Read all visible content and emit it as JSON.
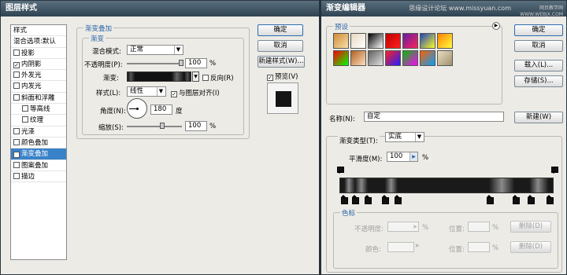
{
  "layer_style": {
    "title": "图层样式",
    "sidebar": [
      {
        "label": "样式",
        "checked": null,
        "indent": false
      },
      {
        "label": "混合选项:默认",
        "checked": null,
        "indent": false
      },
      {
        "label": "投影",
        "checked": false,
        "indent": false
      },
      {
        "label": "内阴影",
        "checked": true,
        "indent": false
      },
      {
        "label": "外发光",
        "checked": false,
        "indent": false
      },
      {
        "label": "内发光",
        "checked": false,
        "indent": false
      },
      {
        "label": "斜面和浮雕",
        "checked": false,
        "indent": false
      },
      {
        "label": "等高线",
        "checked": false,
        "indent": true
      },
      {
        "label": "纹理",
        "checked": false,
        "indent": true
      },
      {
        "label": "光泽",
        "checked": false,
        "indent": false
      },
      {
        "label": "颜色叠加",
        "checked": false,
        "indent": false
      },
      {
        "label": "渐变叠加",
        "checked": true,
        "indent": false,
        "selected": true
      },
      {
        "label": "图案叠加",
        "checked": false,
        "indent": false
      },
      {
        "label": "描边",
        "checked": false,
        "indent": false
      }
    ],
    "section_title": "渐变叠加",
    "subsection_title": "渐变",
    "blend_mode_label": "混合模式:",
    "blend_mode_value": "正常",
    "opacity_label": "不透明度(P):",
    "opacity_value": "100",
    "opacity_unit": "%",
    "gradient_label": "渐变:",
    "reverse_label": "反向(R)",
    "reverse_checked": false,
    "style_label": "样式(L):",
    "style_value": "线性",
    "align_label": "与图层对齐(I)",
    "align_checked": true,
    "angle_label": "角度(N):",
    "angle_value": "180",
    "angle_unit": "度",
    "scale_label": "缩放(S):",
    "scale_value": "100",
    "scale_unit": "%",
    "ok_label": "确定",
    "cancel_label": "取消",
    "new_style_label": "新建样式(W)...",
    "preview_label": "预览(V)",
    "preview_checked": true
  },
  "gradient_editor": {
    "title": "渐变编辑器",
    "watermark": "思缘设计论坛 www.missyuan.com",
    "watermark2": "网页教学网 WWW.WEBJX.COM",
    "presets_label": "预设",
    "presets_menu_icon": "arrow-right-icon",
    "presets": [
      [
        "#d08a3a|#f6e0a6",
        "#e8d8c0|#fff",
        "#000|#fff",
        "#c00000|#ff2020",
        "#6020a0|#ff2060",
        "#2040c0|#ffff20",
        "#ff8000|#ffff40"
      ],
      [
        "#ff0000|#00ff00",
        "#b06020|#ffe0c0",
        "#606060|#e0e0e0",
        "#ff2020|#2020ff",
        "#00c000|#ff00ff",
        "#ff6000|#00a0ff",
        "#e8e0c0|#a09070"
      ]
    ],
    "ok_label": "确定",
    "cancel_label": "取消",
    "load_label": "载入(L)...",
    "save_label": "存储(S)...",
    "name_label": "名称(N):",
    "name_value": "自定",
    "new_label": "新建(W)",
    "type_label": "渐变类型(T):",
    "type_value": "实底",
    "smoothness_label": "平滑度(M):",
    "smoothness_value": "100",
    "smoothness_unit": "%",
    "color_stops_label": "色标",
    "opacity_label": "不透明度:",
    "opacity_unit": "%",
    "location_label": "位置:",
    "location_unit": "%",
    "delete_label": "删除(D)",
    "color_label": "颜色:",
    "gradient_stops": [
      {
        "pos": 0.02,
        "color": "#1a1a1a"
      },
      {
        "pos": 0.04,
        "color": "#8a8a8a"
      },
      {
        "pos": 0.07,
        "color": "#1a1a1a"
      },
      {
        "pos": 0.1,
        "color": "#8a8a8a"
      },
      {
        "pos": 0.13,
        "color": "#1a1a1a"
      },
      {
        "pos": 0.21,
        "color": "#1a1a1a"
      },
      {
        "pos": 0.24,
        "color": "#8a8a8a"
      },
      {
        "pos": 0.27,
        "color": "#1a1a1a"
      },
      {
        "pos": 0.7,
        "color": "#1a1a1a"
      },
      {
        "pos": 0.76,
        "color": "#8a8a8a"
      },
      {
        "pos": 0.82,
        "color": "#1a1a1a"
      },
      {
        "pos": 0.89,
        "color": "#1a1a1a"
      },
      {
        "pos": 0.93,
        "color": "#8a8a8a"
      },
      {
        "pos": 0.98,
        "color": "#1a1a1a"
      }
    ],
    "opacity_stop_positions": [
      0.0,
      1.0
    ]
  },
  "colors": {
    "accent": "#3a82c8",
    "title_text": "#2c64a8"
  }
}
